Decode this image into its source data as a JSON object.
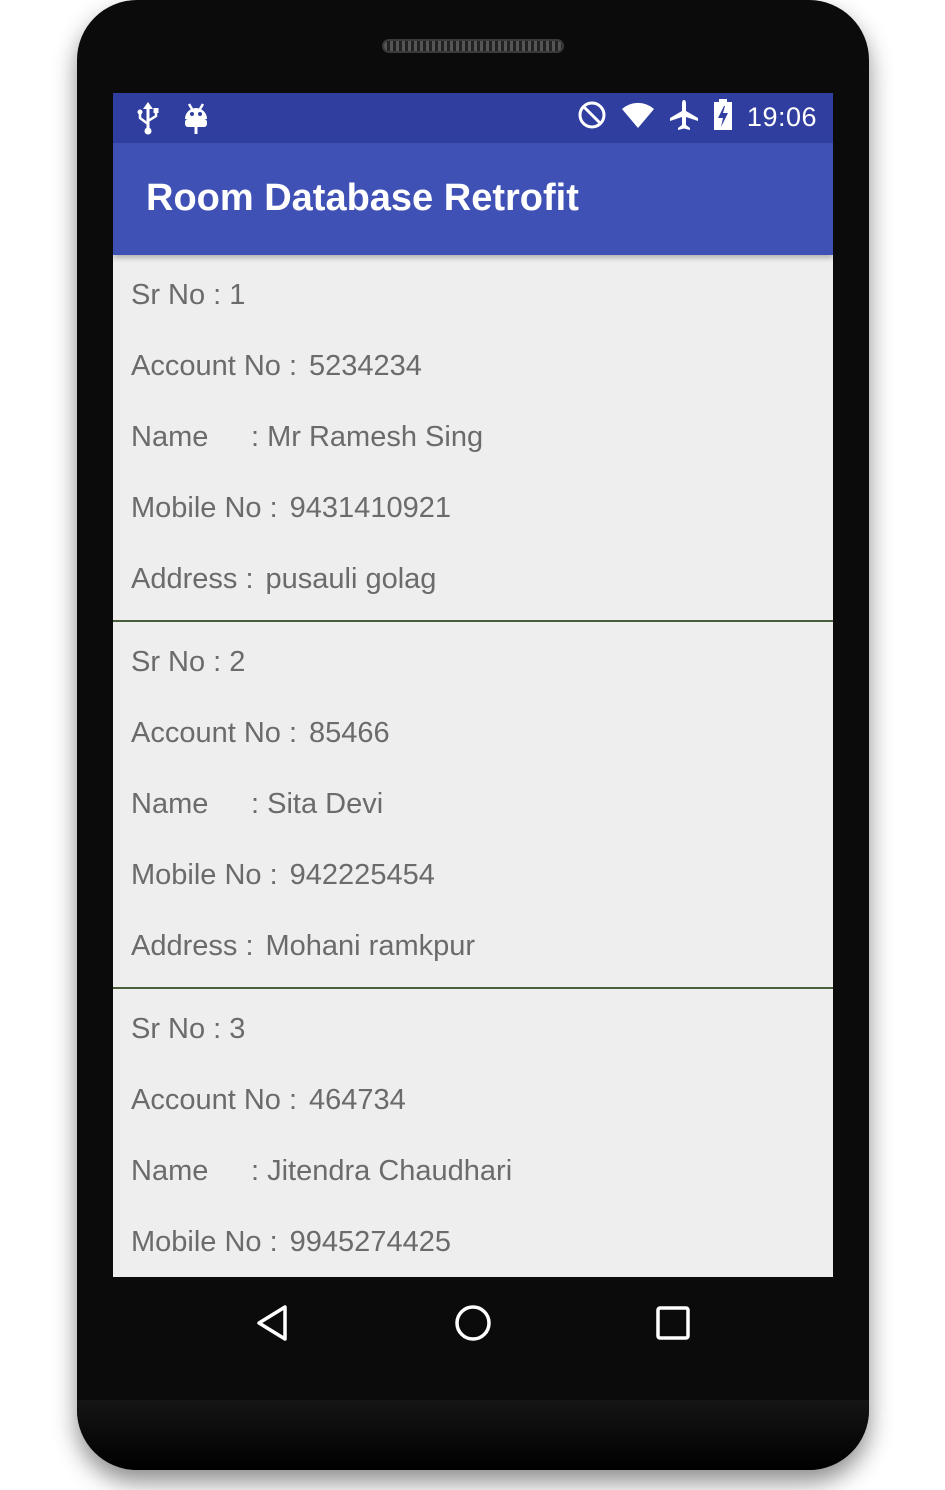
{
  "status_bar": {
    "time": "19:06",
    "left_icons": [
      "usb-icon",
      "android-debug-icon"
    ],
    "right_icons": [
      "do-not-disturb-icon",
      "wifi-icon",
      "airplane-mode-icon",
      "battery-charging-icon"
    ]
  },
  "app_bar": {
    "title": "Room Database Retrofit"
  },
  "records": [
    {
      "sr_label": "Sr No : 1",
      "account_label": "Account No :",
      "account_value": "5234234",
      "name_label": "Name",
      "name_value": ":  Mr Ramesh Sing",
      "mobile_label": "Mobile No  :",
      "mobile_value": "9431410921",
      "address_label": "Address :",
      "address_value": "pusauli golag"
    },
    {
      "sr_label": "Sr No : 2",
      "account_label": "Account No :",
      "account_value": "85466",
      "name_label": "Name",
      "name_value": ":  Sita Devi",
      "mobile_label": "Mobile No  :",
      "mobile_value": "942225454",
      "address_label": "Address :",
      "address_value": "Mohani ramkpur"
    },
    {
      "sr_label": "Sr No : 3",
      "account_label": "Account No :",
      "account_value": "464734",
      "name_label": "Name",
      "name_value": ":  Jitendra Chaudhari",
      "mobile_label": "Mobile No  :",
      "mobile_value": "9945274425"
    }
  ],
  "nav": {
    "back_icon": "back-triangle-icon",
    "home_icon": "home-circle-icon",
    "recents_icon": "recents-square-icon"
  },
  "colors": {
    "status_bar": "#303f9f",
    "app_bar": "#3f51b5",
    "list_background": "#eeeeee",
    "divider": "#4a5e3b",
    "text": "#6b6b6b"
  }
}
